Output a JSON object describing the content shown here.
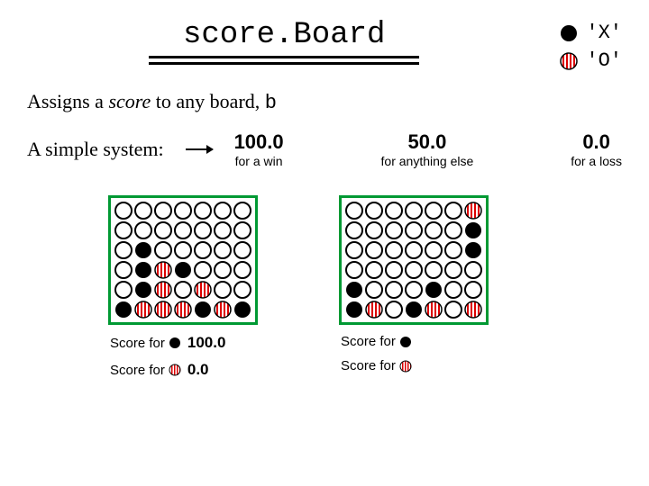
{
  "header": {
    "title": "score.Board"
  },
  "legend": {
    "x": "'X'",
    "o": "'O'"
  },
  "subtitle": {
    "pre": "Assigns a ",
    "italic": "score",
    "mid": " to any board, ",
    "code": "b"
  },
  "system": {
    "label": "A simple system:",
    "win": {
      "value": "100.0",
      "note": "for a win"
    },
    "mid": {
      "value": "50.0",
      "note": "for anything else"
    },
    "loss": {
      "value": "0.0",
      "note": "for a loss"
    }
  },
  "boards": {
    "left": {
      "grid": [
        [
          "E",
          "E",
          "E",
          "E",
          "E",
          "E",
          "E"
        ],
        [
          "E",
          "E",
          "E",
          "E",
          "E",
          "E",
          "E"
        ],
        [
          "E",
          "X",
          "E",
          "E",
          "E",
          "E",
          "E"
        ],
        [
          "E",
          "X",
          "O",
          "X",
          "E",
          "E",
          "E"
        ],
        [
          "E",
          "X",
          "O",
          "E",
          "O",
          "E",
          "E"
        ],
        [
          "X",
          "O",
          "O",
          "O",
          "X",
          "O",
          "X"
        ]
      ],
      "scoreForX": {
        "label": "Score for",
        "value": "100.0"
      },
      "scoreForO": {
        "label": "Score for",
        "value": "0.0"
      }
    },
    "right": {
      "grid": [
        [
          "E",
          "E",
          "E",
          "E",
          "E",
          "E",
          "O"
        ],
        [
          "E",
          "E",
          "E",
          "E",
          "E",
          "E",
          "X"
        ],
        [
          "E",
          "E",
          "E",
          "E",
          "E",
          "E",
          "X"
        ],
        [
          "E",
          "E",
          "E",
          "E",
          "E",
          "E",
          "E"
        ],
        [
          "X",
          "E",
          "E",
          "E",
          "X",
          "E",
          "E"
        ],
        [
          "X",
          "O",
          "E",
          "X",
          "O",
          "E",
          "O"
        ]
      ],
      "scoreForX": {
        "label": "Score for",
        "value": ""
      },
      "scoreForO": {
        "label": "Score for",
        "value": ""
      }
    }
  },
  "chart_data": {
    "type": "table",
    "title": "score.Board scoring rule",
    "rules": [
      {
        "condition": "win",
        "score": 100.0
      },
      {
        "condition": "anything else",
        "score": 50.0
      },
      {
        "condition": "loss",
        "score": 0.0
      }
    ],
    "examples": [
      {
        "board": "left",
        "X_score": 100.0,
        "O_score": 0.0
      },
      {
        "board": "right",
        "X_score": null,
        "O_score": null
      }
    ]
  }
}
